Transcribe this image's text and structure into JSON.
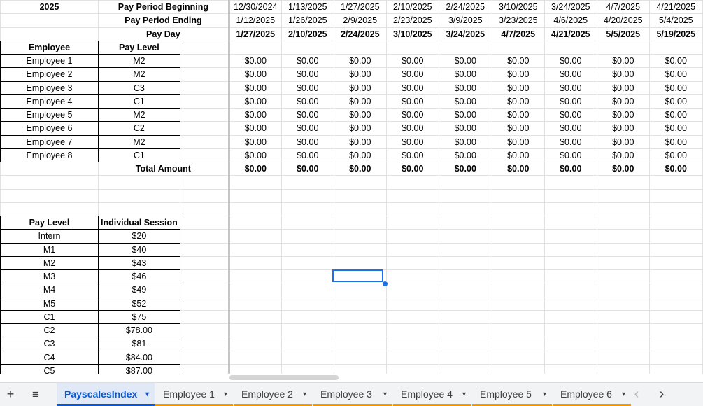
{
  "year_label": "2025",
  "row_labels": {
    "period_beginning": "Pay Period Beginning",
    "period_ending": "Pay Period Ending",
    "pay_day": "Pay Day",
    "total_amount": "Total Amount"
  },
  "periods": [
    {
      "begin": "12/30/2024",
      "end": "1/12/2025",
      "payday": "1/27/2025"
    },
    {
      "begin": "1/13/2025",
      "end": "1/26/2025",
      "payday": "2/10/2025"
    },
    {
      "begin": "1/27/2025",
      "end": "2/9/2025",
      "payday": "2/24/2025"
    },
    {
      "begin": "2/10/2025",
      "end": "2/23/2025",
      "payday": "3/10/2025"
    },
    {
      "begin": "2/24/2025",
      "end": "3/9/2025",
      "payday": "3/24/2025"
    },
    {
      "begin": "3/10/2025",
      "end": "3/23/2025",
      "payday": "4/7/2025"
    },
    {
      "begin": "3/24/2025",
      "end": "4/6/2025",
      "payday": "4/21/2025"
    },
    {
      "begin": "4/7/2025",
      "end": "4/20/2025",
      "payday": "5/5/2025"
    },
    {
      "begin": "4/21/2025",
      "end": "5/4/2025",
      "payday": "5/19/2025"
    }
  ],
  "employee_table": {
    "headers": [
      "Employee",
      "Pay Level"
    ],
    "rows": [
      {
        "name": "Employee 1",
        "level": "M2",
        "amounts": [
          "$0.00",
          "$0.00",
          "$0.00",
          "$0.00",
          "$0.00",
          "$0.00",
          "$0.00",
          "$0.00",
          "$0.00"
        ]
      },
      {
        "name": "Employee 2",
        "level": "M2",
        "amounts": [
          "$0.00",
          "$0.00",
          "$0.00",
          "$0.00",
          "$0.00",
          "$0.00",
          "$0.00",
          "$0.00",
          "$0.00"
        ]
      },
      {
        "name": "Employee 3",
        "level": "C3",
        "amounts": [
          "$0.00",
          "$0.00",
          "$0.00",
          "$0.00",
          "$0.00",
          "$0.00",
          "$0.00",
          "$0.00",
          "$0.00"
        ]
      },
      {
        "name": "Employee 4",
        "level": "C1",
        "amounts": [
          "$0.00",
          "$0.00",
          "$0.00",
          "$0.00",
          "$0.00",
          "$0.00",
          "$0.00",
          "$0.00",
          "$0.00"
        ]
      },
      {
        "name": "Employee 5",
        "level": "M2",
        "amounts": [
          "$0.00",
          "$0.00",
          "$0.00",
          "$0.00",
          "$0.00",
          "$0.00",
          "$0.00",
          "$0.00",
          "$0.00"
        ]
      },
      {
        "name": "Employee 6",
        "level": "C2",
        "amounts": [
          "$0.00",
          "$0.00",
          "$0.00",
          "$0.00",
          "$0.00",
          "$0.00",
          "$0.00",
          "$0.00",
          "$0.00"
        ]
      },
      {
        "name": "Employee 7",
        "level": "M2",
        "amounts": [
          "$0.00",
          "$0.00",
          "$0.00",
          "$0.00",
          "$0.00",
          "$0.00",
          "$0.00",
          "$0.00",
          "$0.00"
        ]
      },
      {
        "name": "Employee 8",
        "level": "C1",
        "amounts": [
          "$0.00",
          "$0.00",
          "$0.00",
          "$0.00",
          "$0.00",
          "$0.00",
          "$0.00",
          "$0.00",
          "$0.00"
        ]
      }
    ],
    "totals": [
      "$0.00",
      "$0.00",
      "$0.00",
      "$0.00",
      "$0.00",
      "$0.00",
      "$0.00",
      "$0.00",
      "$0.00"
    ]
  },
  "paylevel_table": {
    "headers": [
      "Pay Level",
      "Individual Session"
    ],
    "rows": [
      {
        "level": "Intern",
        "rate": "$20"
      },
      {
        "level": "M1",
        "rate": "$40"
      },
      {
        "level": "M2",
        "rate": "$43"
      },
      {
        "level": "M3",
        "rate": "$46"
      },
      {
        "level": "M4",
        "rate": "$49"
      },
      {
        "level": "M5",
        "rate": "$52"
      },
      {
        "level": "C1",
        "rate": "$75"
      },
      {
        "level": "C2",
        "rate": "$78.00"
      },
      {
        "level": "C3",
        "rate": "$81"
      },
      {
        "level": "C4",
        "rate": "$84.00"
      },
      {
        "level": "C5",
        "rate": "$87.00"
      }
    ]
  },
  "tabbar": {
    "add_icon": "+",
    "list_icon": "≡",
    "prev_icon": "‹",
    "next_icon": "›",
    "tabs": [
      {
        "label": "PayscalesIndex",
        "active": true
      },
      {
        "label": "Employee 1",
        "active": false
      },
      {
        "label": "Employee 2",
        "active": false
      },
      {
        "label": "Employee 3",
        "active": false
      },
      {
        "label": "Employee 4",
        "active": false
      },
      {
        "label": "Employee 5",
        "active": false
      },
      {
        "label": "Employee 6",
        "active": false
      }
    ],
    "caret": "▾"
  },
  "colors": {
    "selection": "#1a73e8",
    "active_tab_bg": "#e1e9f7",
    "active_tab_text": "#0b57d0",
    "tab_underline": "#f29900"
  }
}
